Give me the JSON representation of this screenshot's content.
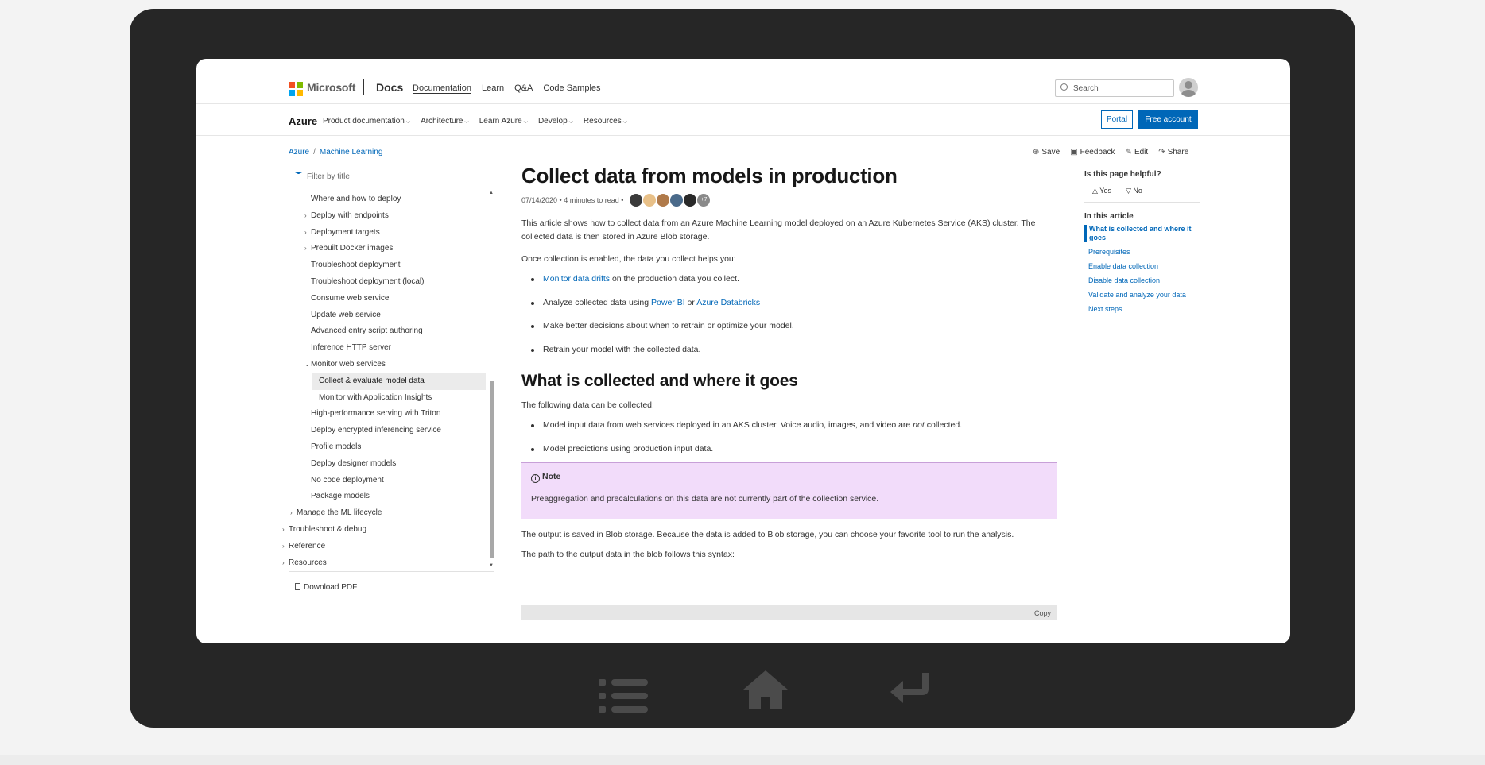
{
  "header": {
    "brand": "Microsoft",
    "product": "Docs",
    "nav": [
      "Documentation",
      "Learn",
      "Q&A",
      "Code Samples"
    ],
    "search_placeholder": "Search"
  },
  "subheader": {
    "title": "Azure",
    "nav": [
      "Product documentation",
      "Architecture",
      "Learn Azure",
      "Develop",
      "Resources"
    ],
    "portal_label": "Portal",
    "free_account_label": "Free account"
  },
  "breadcrumb": [
    "Azure",
    "Machine Learning"
  ],
  "actions": [
    "Save",
    "Feedback",
    "Edit",
    "Share"
  ],
  "toc": {
    "filter_placeholder": "Filter by title",
    "items": [
      {
        "label": "Where and how to deploy",
        "level": 2,
        "chevron": ""
      },
      {
        "label": "Deploy with endpoints",
        "level": 2,
        "chevron": ">"
      },
      {
        "label": "Deployment targets",
        "level": 2,
        "chevron": ">"
      },
      {
        "label": "Prebuilt Docker images",
        "level": 2,
        "chevron": ">"
      },
      {
        "label": "Troubleshoot deployment",
        "level": 2,
        "chevron": ""
      },
      {
        "label": "Troubleshoot deployment (local)",
        "level": 2,
        "chevron": ""
      },
      {
        "label": "Consume web service",
        "level": 2,
        "chevron": ""
      },
      {
        "label": "Update web service",
        "level": 2,
        "chevron": ""
      },
      {
        "label": "Advanced entry script authoring",
        "level": 2,
        "chevron": ""
      },
      {
        "label": "Inference HTTP server",
        "level": 2,
        "chevron": ""
      },
      {
        "label": "Monitor web services",
        "level": 2,
        "chevron": "v"
      },
      {
        "label": "Collect & evaluate model data",
        "level": 3,
        "chevron": "",
        "active": true
      },
      {
        "label": "Monitor with Application Insights",
        "level": 3,
        "chevron": ""
      },
      {
        "label": "High-performance serving with Triton",
        "level": 2,
        "chevron": ""
      },
      {
        "label": "Deploy encrypted inferencing service",
        "level": 2,
        "chevron": ""
      },
      {
        "label": "Profile models",
        "level": 2,
        "chevron": ""
      },
      {
        "label": "Deploy designer models",
        "level": 2,
        "chevron": ""
      },
      {
        "label": "No code deployment",
        "level": 2,
        "chevron": ""
      },
      {
        "label": "Package models",
        "level": 2,
        "chevron": ""
      },
      {
        "label": "Manage the ML lifecycle",
        "level": 1,
        "chevron": ">"
      },
      {
        "label": "Troubleshoot & debug",
        "level": 0,
        "chevron": ">"
      },
      {
        "label": "Reference",
        "level": 0,
        "chevron": ">"
      },
      {
        "label": "Resources",
        "level": 0,
        "chevron": ">"
      }
    ],
    "download_pdf": "Download PDF"
  },
  "article": {
    "title": "Collect data from models in production",
    "meta": "07/14/2020 • 4 minutes to read •",
    "more_contributors": "+7",
    "intro": "This article shows how to collect data from an Azure Machine Learning model deployed on an Azure Kubernetes Service (AKS) cluster. The collected data is then stored in Azure Blob storage.",
    "helps_intro": "Once collection is enabled, the data you collect helps you:",
    "bullet1_link": "Monitor data drifts",
    "bullet1_rest": " on the production data you collect.",
    "bullet2_pre": "Analyze collected data using ",
    "bullet2_link1": "Power BI",
    "bullet2_mid": " or ",
    "bullet2_link2": "Azure Databricks",
    "bullet3": "Make better decisions about when to retrain or optimize your model.",
    "bullet4": "Retrain your model with the collected data.",
    "h2": "What is collected and where it goes",
    "collected_intro": "The following data can be collected:",
    "collected1_pre": "Model input data from web services deployed in an AKS cluster. Voice audio, images, and video are ",
    "collected1_em": "not",
    "collected1_post": " collected.",
    "collected2": "Model predictions using production input data.",
    "note_title": "Note",
    "note_body": "Preaggregation and precalculations on this data are not currently part of the collection service.",
    "output_p": "The output is saved in Blob storage. Because the data is added to Blob storage, you can choose your favorite tool to run the analysis.",
    "path_p": "The path to the output data in the blob follows this syntax:",
    "copy_label": "Copy"
  },
  "rail": {
    "helpful_title": "Is this page helpful?",
    "yes": "Yes",
    "no": "No",
    "in_article_title": "In this article",
    "links": [
      "What is collected and where it goes",
      "Prerequisites",
      "Enable data collection",
      "Disable data collection",
      "Validate and analyze your data",
      "Next steps"
    ]
  },
  "colors": {
    "accent": "#0067b8",
    "note_bg": "#f2dcfa",
    "device": "#262626"
  },
  "icons": [
    "search-icon",
    "user-avatar-icon",
    "save-icon",
    "feedback-icon",
    "edit-icon",
    "share-icon",
    "filter-icon",
    "document-icon",
    "thumbs-up-icon",
    "thumbs-down-icon",
    "info-icon",
    "list-icon",
    "home-icon",
    "back-icon"
  ]
}
